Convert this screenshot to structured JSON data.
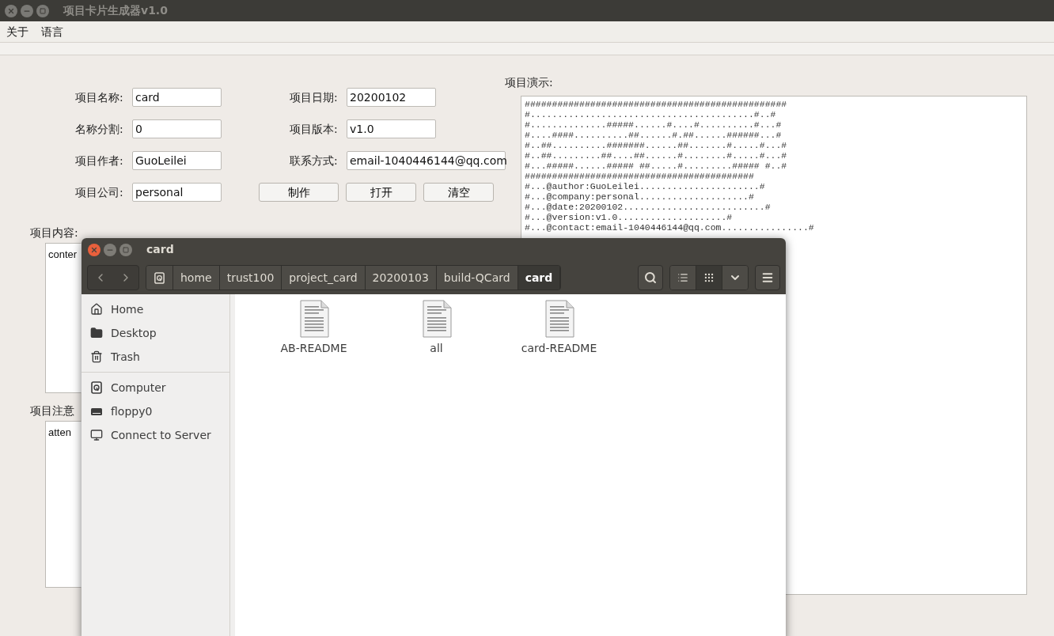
{
  "main_window": {
    "title": "项目卡片生成器v1.0",
    "menu": [
      "关于",
      "语言"
    ],
    "left_fields": [
      {
        "label": "项目名称:",
        "value": "card"
      },
      {
        "label": "名称分割:",
        "value": "0"
      },
      {
        "label": "项目作者:",
        "value": "GuoLeilei"
      },
      {
        "label": "项目公司:",
        "value": "personal"
      }
    ],
    "right_fields": [
      {
        "label": "项目日期:",
        "value": "20200102"
      },
      {
        "label": "项目版本:",
        "value": "v1.0"
      },
      {
        "label": "联系方式:",
        "value": "email-1040446144@qq.com"
      }
    ],
    "buttons": [
      "制作",
      "打开",
      "清空"
    ],
    "content": {
      "label": "项目内容:",
      "value": "conter"
    },
    "notes": {
      "label": "项目注意",
      "value": "atten"
    },
    "preview": {
      "label": "项目演示:",
      "lines": [
        "################################################",
        "#.........................................#..#",
        "#..............#####......#....#..........#...#",
        "#....####..........##......#.##......######...#",
        "#..##..........#######......##.......#.....#...#",
        "#..##.........##....##......#........#.....#...#",
        "#...#####......##### ##.....#.........##### #..#",
        "##########################################",
        "#...@author:GuoLeilei......................#",
        "#...@company:personal....................#",
        "#...@date:20200102..........................#",
        "#...@version:v1.0....................#",
        "#...@contact:email-1040446144@qq.com................#"
      ]
    }
  },
  "file_window": {
    "title": "card",
    "path": [
      {
        "kind": "drive",
        "selected": false
      },
      {
        "label": "home",
        "selected": false
      },
      {
        "label": "trust100",
        "selected": false
      },
      {
        "label": "project_card",
        "selected": false
      },
      {
        "label": "20200103",
        "selected": false
      },
      {
        "label": "build-QCard",
        "selected": false
      },
      {
        "label": "card",
        "selected": true
      }
    ],
    "view_modes": [
      {
        "kind": "list",
        "selected": false
      },
      {
        "kind": "grid",
        "selected": true
      }
    ],
    "sidebar": [
      [
        {
          "kind": "home",
          "label": "Home"
        },
        {
          "kind": "folder",
          "label": "Desktop"
        },
        {
          "kind": "trash",
          "label": "Trash"
        }
      ],
      [
        {
          "kind": "computer",
          "label": "Computer"
        },
        {
          "kind": "drive",
          "label": "floppy0"
        },
        {
          "kind": "server",
          "label": "Connect to Server"
        }
      ]
    ],
    "files": [
      "AB-README",
      "all",
      "card-README"
    ]
  }
}
